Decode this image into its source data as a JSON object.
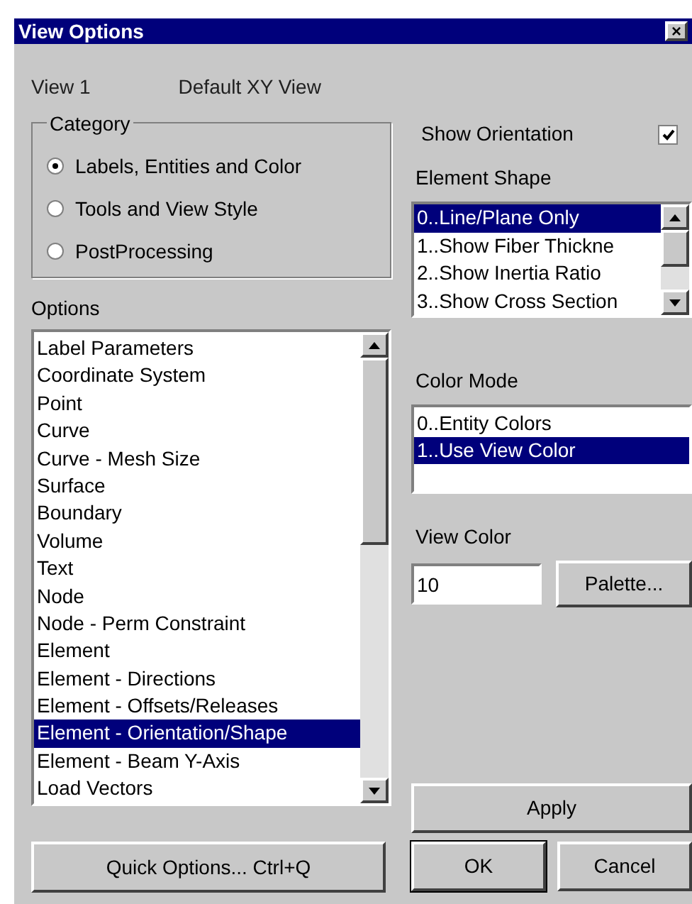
{
  "window": {
    "title": "View Options",
    "close": "×"
  },
  "view": {
    "name": "View 1",
    "description": "Default XY View"
  },
  "category": {
    "title": "Category",
    "options": [
      {
        "label": "Labels, Entities and Color",
        "selected": true
      },
      {
        "label": "Tools and View Style",
        "selected": false
      },
      {
        "label": "PostProcessing",
        "selected": false
      }
    ]
  },
  "options": {
    "title": "Options",
    "items": [
      {
        "label": "Label Parameters",
        "selected": false
      },
      {
        "label": "Coordinate System",
        "selected": false
      },
      {
        "label": "Point",
        "selected": false
      },
      {
        "label": "Curve",
        "selected": false
      },
      {
        "label": "Curve - Mesh Size",
        "selected": false
      },
      {
        "label": "Surface",
        "selected": false
      },
      {
        "label": "Boundary",
        "selected": false
      },
      {
        "label": "Volume",
        "selected": false
      },
      {
        "label": "Text",
        "selected": false
      },
      {
        "label": "Node",
        "selected": false
      },
      {
        "label": "Node - Perm Constraint",
        "selected": false
      },
      {
        "label": "Element",
        "selected": false
      },
      {
        "label": "Element - Directions",
        "selected": false
      },
      {
        "label": "Element - Offsets/Releases",
        "selected": false
      },
      {
        "label": "Element - Orientation/Shape",
        "selected": true
      },
      {
        "label": "Element - Beam Y-Axis",
        "selected": false
      },
      {
        "label": "Load Vectors",
        "selected": false
      }
    ]
  },
  "show_orientation": {
    "label": "Show Orientation",
    "checked": true
  },
  "element_shape": {
    "title": "Element Shape",
    "items": [
      {
        "label": "0..Line/Plane Only",
        "selected": true
      },
      {
        "label": "1..Show Fiber Thickne",
        "selected": false
      },
      {
        "label": "2..Show Inertia Ratio",
        "selected": false
      },
      {
        "label": "3..Show Cross Section",
        "selected": false
      }
    ]
  },
  "color_mode": {
    "title": "Color Mode",
    "items": [
      {
        "label": "0..Entity Colors",
        "selected": false
      },
      {
        "label": "1..Use View Color",
        "selected": true
      }
    ]
  },
  "view_color": {
    "label": "View Color",
    "value": "10",
    "button": "Palette..."
  },
  "buttons": {
    "quick_options": "Quick Options...  Ctrl+Q",
    "apply": "Apply",
    "ok": "OK",
    "cancel": "Cancel"
  }
}
